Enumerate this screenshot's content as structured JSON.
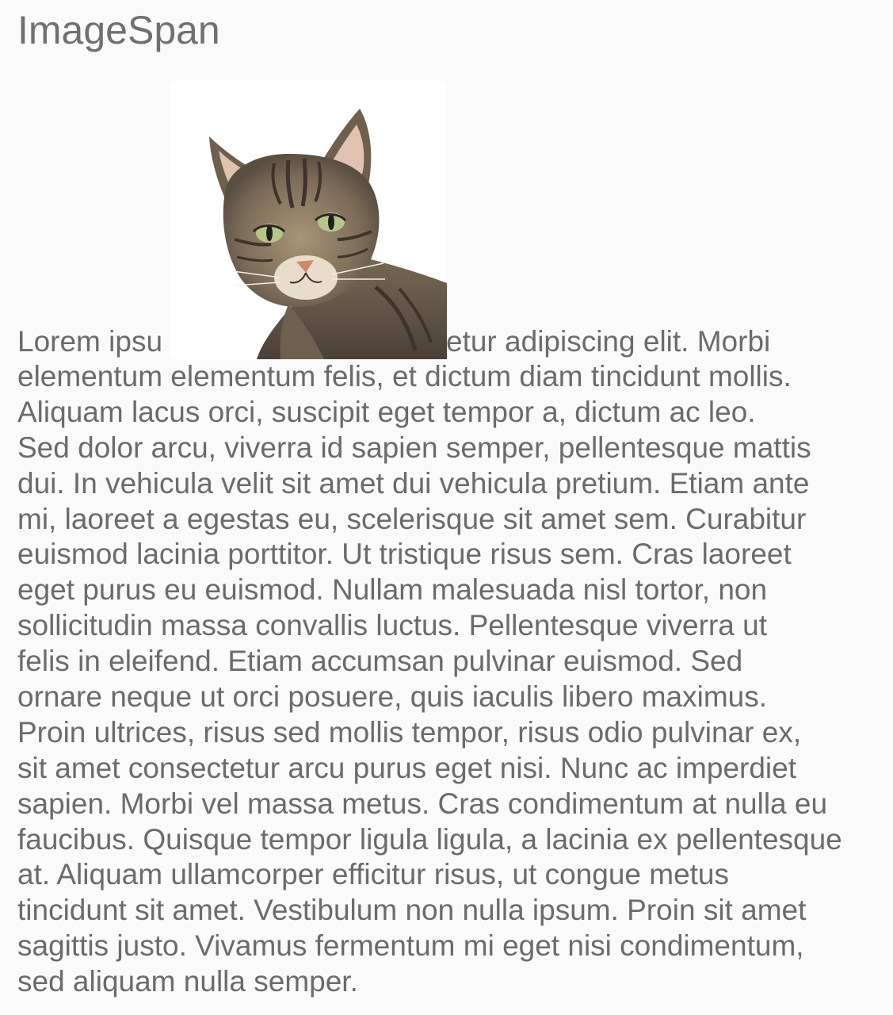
{
  "header": {
    "title": "ImageSpan"
  },
  "content": {
    "first_line_before_image": "Lorem ipsu",
    "first_line_after_image": "etur adipiscing elit. Morbi",
    "image_icon": "cat-photo",
    "lines": [
      "elementum elementum felis, et dictum diam tincidunt mollis.",
      "Aliquam lacus orci, suscipit eget tempor a, dictum ac leo.",
      "Sed dolor arcu, viverra id sapien semper, pellentesque mattis",
      "dui. In vehicula velit sit amet dui vehicula pretium. Etiam ante",
      "mi, laoreet a egestas eu, scelerisque sit amet sem. Curabitur",
      "euismod lacinia porttitor. Ut tristique risus sem. Cras laoreet",
      "eget purus eu euismod. Nullam malesuada nisl tortor, non",
      "sollicitudin massa convallis luctus. Pellentesque viverra ut",
      "felis in eleifend. Etiam accumsan pulvinar euismod. Sed",
      "ornare neque ut orci posuere, quis iaculis libero maximus.",
      "Proin ultrices, risus sed mollis tempor, risus odio pulvinar ex,",
      "sit amet consectetur arcu purus eget nisi. Nunc ac imperdiet",
      "sapien. Morbi vel massa metus. Cras condimentum at nulla eu",
      "faucibus. Quisque tempor ligula ligula, a lacinia ex pellentesque",
      "at. Aliquam ullamcorper efficitur risus, ut congue metus",
      "tincidunt sit amet. Vestibulum non nulla ipsum. Proin sit amet",
      "sagittis justo. Vivamus fermentum mi eget nisi condimentum,",
      "sed aliquam nulla semper."
    ]
  },
  "colors": {
    "background": "#fafafa",
    "text": "#6b6b6b"
  }
}
